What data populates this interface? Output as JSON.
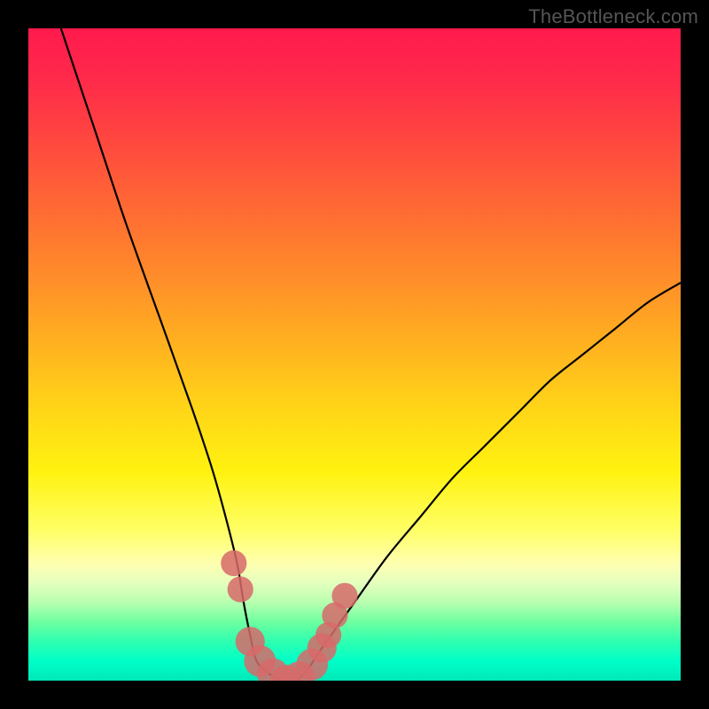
{
  "watermark": "TheBottleneck.com",
  "chart_data": {
    "type": "line",
    "title": "",
    "xlabel": "",
    "ylabel": "",
    "xlim": [
      0,
      100
    ],
    "ylim": [
      0,
      100
    ],
    "series": [
      {
        "name": "bottleneck-curve",
        "x": [
          5,
          10,
          15,
          20,
          25,
          28,
          30,
          32,
          33,
          34,
          35,
          37,
          39,
          41,
          43,
          45,
          50,
          55,
          60,
          65,
          70,
          75,
          80,
          85,
          90,
          95,
          100
        ],
        "values": [
          100,
          85,
          70,
          56,
          42,
          33,
          26,
          18,
          12,
          7,
          3,
          1,
          0,
          0,
          2,
          5,
          12,
          19,
          25,
          31,
          36,
          41,
          46,
          50,
          54,
          58,
          61
        ]
      }
    ],
    "markers": [
      {
        "x": 31.5,
        "y": 18,
        "r": 1.3
      },
      {
        "x": 32.5,
        "y": 14,
        "r": 1.3
      },
      {
        "x": 34.0,
        "y": 6,
        "r": 1.6
      },
      {
        "x": 35.5,
        "y": 3,
        "r": 1.8
      },
      {
        "x": 37.5,
        "y": 1,
        "r": 1.8
      },
      {
        "x": 39.5,
        "y": 0,
        "r": 1.8
      },
      {
        "x": 41.5,
        "y": 0.5,
        "r": 1.8
      },
      {
        "x": 43.5,
        "y": 2.5,
        "r": 1.8
      },
      {
        "x": 45.0,
        "y": 5,
        "r": 1.6
      },
      {
        "x": 46.0,
        "y": 7,
        "r": 1.3
      },
      {
        "x": 47.0,
        "y": 10,
        "r": 1.3
      },
      {
        "x": 48.5,
        "y": 13,
        "r": 1.3
      }
    ],
    "colors": {
      "curve": "#000000",
      "marker": "#d76a6a"
    }
  }
}
